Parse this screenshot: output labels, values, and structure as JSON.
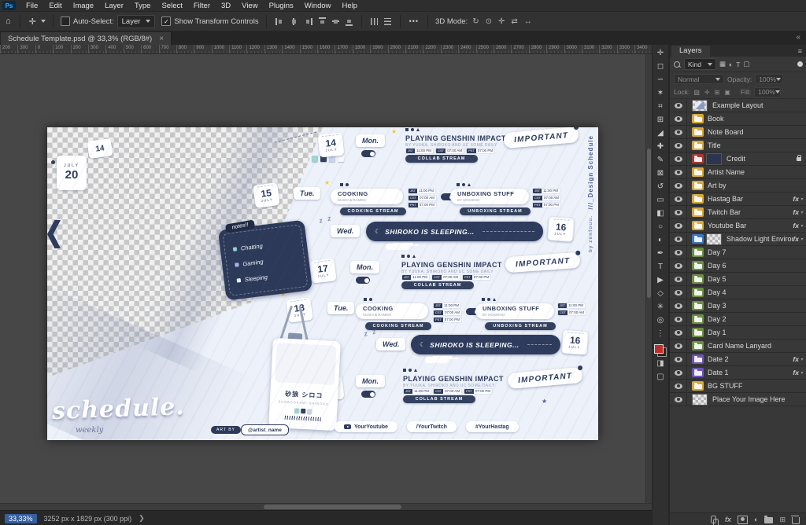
{
  "app": {
    "logo": "Ps"
  },
  "menu_items": [
    "File",
    "Edit",
    "Image",
    "Layer",
    "Type",
    "Select",
    "Filter",
    "3D",
    "View",
    "Plugins",
    "Window",
    "Help"
  ],
  "options": {
    "auto_select": "Auto-Select:",
    "auto_select_mode": "Layer",
    "show_transform": "Show Transform Controls",
    "more": "•••",
    "mode_3d": "3D Mode:"
  },
  "doc_tab": {
    "title": "Schedule Template.psd @ 33,3% (RGB/8#)",
    "close": "×"
  },
  "ruler_ticks": [
    "200",
    "300",
    "0",
    "100",
    "200",
    "300",
    "400",
    "500",
    "600",
    "700",
    "800",
    "900",
    "1000",
    "1100",
    "1200",
    "1300",
    "1400",
    "1500",
    "1600",
    "1700",
    "1800",
    "1900",
    "2000",
    "2100",
    "2200",
    "2300",
    "2400",
    "2500",
    "2600",
    "2700",
    "2800",
    "2900",
    "3000",
    "3100",
    "3200",
    "3300",
    "3400"
  ],
  "layers_panel": {
    "tab": "Layers",
    "kind_label": "Kind",
    "blend_mode": "Normal",
    "opacity_label": "Opacity:",
    "opacity_value": "100%",
    "lock_label": "Lock:",
    "fill_label": "Fill:",
    "fill_value": "100%",
    "fx_label": "fx",
    "layers": [
      {
        "name": "Example Layout",
        "color": "none",
        "thumb": true
      },
      {
        "name": "Book",
        "color": "yellow"
      },
      {
        "name": "Note Board",
        "color": "yellow"
      },
      {
        "name": "Title",
        "color": "yellow"
      },
      {
        "name": "Credit",
        "color": "red",
        "locked": true,
        "thumb": true
      },
      {
        "name": "Artist Name",
        "color": "yellow"
      },
      {
        "name": "Art by",
        "color": "yellow"
      },
      {
        "name": "Hastag Bar",
        "color": "yellow",
        "fx": true
      },
      {
        "name": "Twitch Bar",
        "color": "yellow",
        "fx": true
      },
      {
        "name": "Youtube Bar",
        "color": "yellow",
        "fx": true
      },
      {
        "name": "Shadow Light Environment",
        "color": "blue",
        "fx": true,
        "thumb": true
      },
      {
        "name": "Day 7",
        "color": "green"
      },
      {
        "name": "Day 6",
        "color": "green"
      },
      {
        "name": "Day 5",
        "color": "green"
      },
      {
        "name": "Day 4",
        "color": "green"
      },
      {
        "name": "Day 3",
        "color": "green"
      },
      {
        "name": "Day 2",
        "color": "green"
      },
      {
        "name": "Day 1",
        "color": "green"
      },
      {
        "name": "Card Name Lanyard",
        "color": "green"
      },
      {
        "name": "Date 2",
        "color": "purple",
        "fx": true
      },
      {
        "name": "Date 1",
        "color": "purple",
        "fx": true
      },
      {
        "name": "BG STUFF",
        "color": "yellow"
      },
      {
        "name": "Place Your Image Here",
        "color": "none",
        "thumb": true
      }
    ]
  },
  "status_bar": {
    "zoom": "33,33%",
    "doc_info": "3252 px x 1829 px (300 ppi)"
  },
  "canvas": {
    "month": "JULY",
    "top_tab": "14",
    "top_date": {
      "month": "JULY",
      "day": "20"
    },
    "dates": {
      "d14": "14",
      "d15": "15",
      "d16": "16",
      "d17": "17",
      "d18": "18",
      "d20": "20"
    },
    "days": {
      "mon": "Mon.",
      "tue": "Tue.",
      "wed": "Wed."
    },
    "genshin": {
      "title": "PLAYING GENSHIN IMPACT",
      "sub": "BY YUUKA, SHIROKO AND UC SOME DAILY",
      "pill": "COLLAB STREAM"
    },
    "cooking": {
      "title": "COOKING",
      "sub": "SUSHI & RAMEN",
      "pill": "COOKING STREAM"
    },
    "unboxing": {
      "title": "UNBOXING STUFF",
      "sub": "BY HOSHINO",
      "pill": "UNBOXING STREAM"
    },
    "sleeping": "SHIROKO IS SLEEPING...",
    "important": "IMPORTANT",
    "times": {
      "t1": "11:00 PM",
      "t2": "07:00 AM",
      "t3": "07:00 PM"
    },
    "time_zones": {
      "z1": "JST",
      "z2": "CST",
      "z3": "PST"
    },
    "notes": {
      "title": "notes!!",
      "item1": "Chatting",
      "item2": "Gaming",
      "item3": "Sleeping"
    },
    "card": {
      "name": "砂狼 シロコ",
      "romaji": "SUNAOOKAMI  SHIROKO"
    },
    "script_title": "schedule.",
    "script_sub": "weekly",
    "art_by": "ART BY",
    "artist_handle": "@artist_name",
    "socials": {
      "youtube": "YourYoutube",
      "twitch": "/YourTwitch",
      "hashtag": "#YourHastag"
    },
    "side_credit": "///_Design Schedule",
    "side_credit2": "by zenfouu.",
    "zzz": "z z",
    "moon": "☾"
  }
}
